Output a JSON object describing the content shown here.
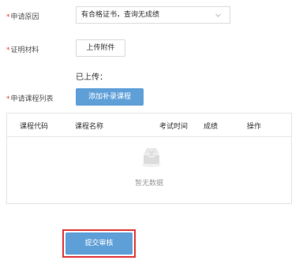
{
  "form": {
    "reason": {
      "required_mark": "*",
      "label": "申请原因",
      "selected_value": "有合格证书，查询无成绩"
    },
    "proof": {
      "required_mark": "*",
      "label": "证明材料",
      "upload_button": "上传附件",
      "uploaded_label": "已上传："
    },
    "courses": {
      "required_mark": "*",
      "label": "申请课程列表",
      "add_button": "添加补录课程"
    }
  },
  "table": {
    "columns": [
      "课程代码",
      "课程名称",
      "考试时间",
      "成绩",
      "操作"
    ],
    "rows": [],
    "empty_text": "暂无数据"
  },
  "submit_button": "提交审核",
  "icons": {
    "select_chevron": "chevron-down-icon",
    "empty_state": "empty-inbox-icon"
  },
  "colors": {
    "primary": "#5f9fd8",
    "required": "#e04848",
    "highlight_border": "#e03a3a"
  }
}
